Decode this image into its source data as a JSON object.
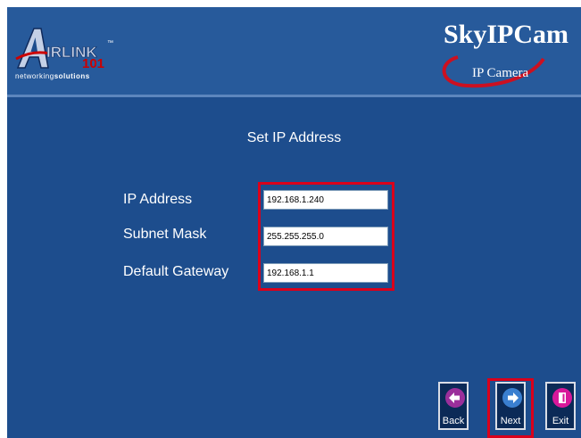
{
  "header": {
    "airlink_logo": {
      "brand_text": "IRLINK",
      "number_text": "101",
      "tm": "™"
    },
    "airlink_tagline_prefix": "networking",
    "airlink_tagline_bold": "solutions",
    "product_title": "SkyIPCam",
    "product_subtitle": "IP Camera"
  },
  "page_title": "Set IP Address",
  "form": {
    "ip_address": {
      "label": "IP Address",
      "value": "192.168.1.240"
    },
    "subnet_mask": {
      "label": "Subnet Mask",
      "value": "255.255.255.0"
    },
    "default_gateway": {
      "label": "Default Gateway",
      "value": "192.168.1.1"
    }
  },
  "buttons": {
    "back": {
      "label": "Back",
      "color": "#9b2f9b",
      "icon": "left-arrow-icon"
    },
    "next": {
      "label": "Next",
      "color": "#3a7fd0",
      "icon": "right-arrow-icon"
    },
    "exit": {
      "label": "Exit",
      "color": "#d8189a",
      "icon": "door-icon"
    }
  },
  "colors": {
    "background": "#1d4d8d",
    "header": "#275a9b",
    "highlight": "#d9001b"
  }
}
